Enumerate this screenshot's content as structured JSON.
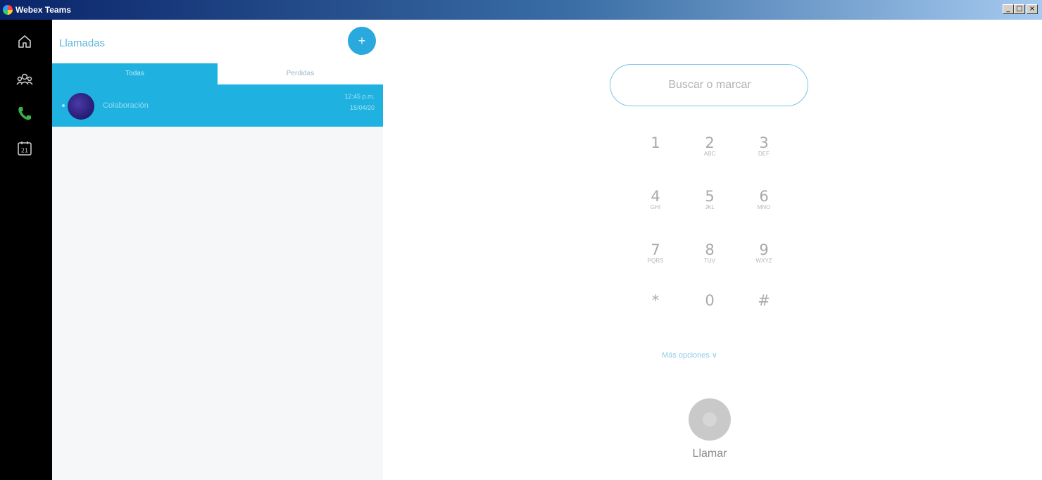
{
  "window": {
    "title": "Webex Teams",
    "controls": [
      "_",
      "□",
      "×"
    ]
  },
  "rail": {
    "items": [
      {
        "name": "home-icon"
      },
      {
        "name": "teams-icon"
      },
      {
        "name": "phone-icon",
        "active": true,
        "color": "#3bb34a"
      },
      {
        "name": "calendar-icon",
        "text": "21"
      }
    ]
  },
  "panel": {
    "title": "Llamadas",
    "add_button": "+",
    "tabs": [
      {
        "label": "Todas",
        "active": true
      },
      {
        "label": "Perdidas",
        "active": false
      }
    ],
    "calls": [
      {
        "name": "Colaboración",
        "time": "12:45 p.m.",
        "date": "15/04/20"
      }
    ]
  },
  "dialer": {
    "search_placeholder": "Buscar o marcar",
    "keys": [
      {
        "digit": "1",
        "letters": ""
      },
      {
        "digit": "2",
        "letters": "ABC"
      },
      {
        "digit": "3",
        "letters": "DEF"
      },
      {
        "digit": "4",
        "letters": "GHI"
      },
      {
        "digit": "5",
        "letters": "JKL"
      },
      {
        "digit": "6",
        "letters": "MNO"
      },
      {
        "digit": "7",
        "letters": "PQRS"
      },
      {
        "digit": "8",
        "letters": "TUV"
      },
      {
        "digit": "9",
        "letters": "WXYZ"
      },
      {
        "digit": "*",
        "letters": ""
      },
      {
        "digit": "0",
        "letters": ""
      },
      {
        "digit": "#",
        "letters": ""
      }
    ],
    "more_options": "Más opciones ∨",
    "call_label": "Llamar"
  },
  "colors": {
    "accent": "#1fb2e0",
    "rail_bg": "#000000",
    "active_phone": "#3bb34a"
  }
}
